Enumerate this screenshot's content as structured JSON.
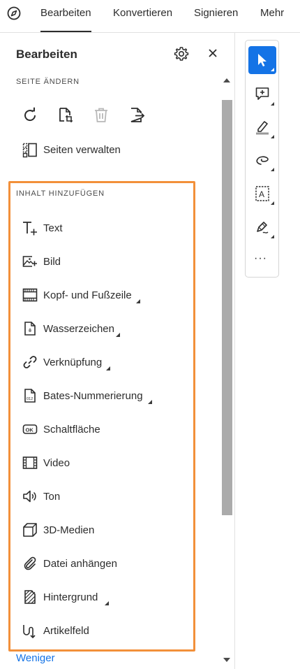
{
  "tabs": [
    {
      "label": "Bearbeiten"
    },
    {
      "label": "Konvertieren"
    },
    {
      "label": "Signieren"
    },
    {
      "label": "Mehr"
    }
  ],
  "panel": {
    "title": "Bearbeiten",
    "section_page": "SEITE ÄNDERN",
    "manage_pages": "Seiten verwalten",
    "section_add": "INHALT HINZUFÜGEN",
    "items": [
      {
        "label": "Text",
        "icon": "add-text-icon",
        "submenu": false
      },
      {
        "label": "Bild",
        "icon": "add-image-icon",
        "submenu": false
      },
      {
        "label": "Kopf- und Fußzeile",
        "icon": "header-footer-icon",
        "submenu": true
      },
      {
        "label": "Wasserzeichen",
        "icon": "watermark-icon",
        "submenu": true
      },
      {
        "label": "Verknüpfung",
        "icon": "link-icon",
        "submenu": true
      },
      {
        "label": "Bates-Nummerierung",
        "icon": "bates-numbering-icon",
        "submenu": true
      },
      {
        "label": "Schaltfläche",
        "icon": "ok-button-icon",
        "submenu": false
      },
      {
        "label": "Video",
        "icon": "video-icon",
        "submenu": false
      },
      {
        "label": "Ton",
        "icon": "sound-icon",
        "submenu": false
      },
      {
        "label": "3D-Medien",
        "icon": "3d-cube-icon",
        "submenu": false
      },
      {
        "label": "Datei anhängen",
        "icon": "paperclip-icon",
        "submenu": false
      },
      {
        "label": "Hintergrund",
        "icon": "background-icon",
        "submenu": true
      },
      {
        "label": "Artikelfeld",
        "icon": "article-icon",
        "submenu": false
      }
    ],
    "less_link": "Weniger"
  },
  "right_toolbar": {
    "tools": [
      "select-cursor-icon",
      "add-comment-icon",
      "highlight-icon",
      "draw-lasso-icon",
      "text-box-icon",
      "sign-pen-icon"
    ],
    "more": "···"
  },
  "colors": {
    "accent": "#1473e6",
    "highlight_border": "#f2903a",
    "text": "#2c2c2c"
  }
}
